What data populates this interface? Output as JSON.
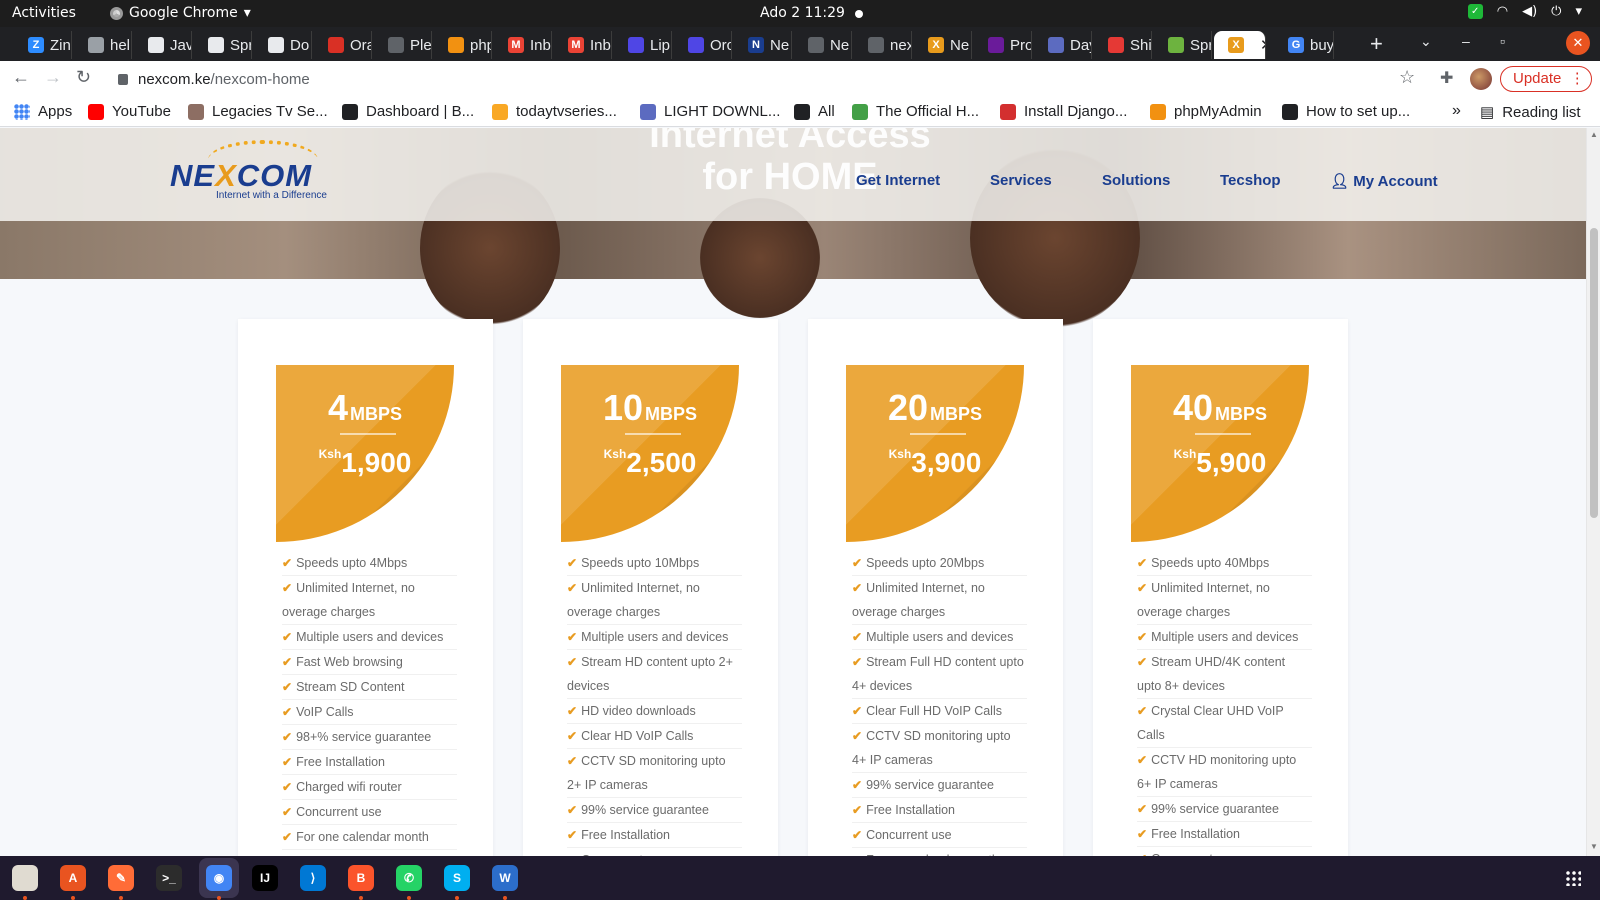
{
  "system_bar": {
    "activities": "Activities",
    "app_name": "Google Chrome",
    "clock": "Ado 2  11:29"
  },
  "tabs": [
    {
      "label": "Zin",
      "icon": "Z",
      "color": "#2d8cff"
    },
    {
      "label": "hel",
      "icon": "",
      "color": "#9aa0a6"
    },
    {
      "label": "Jav",
      "icon": "",
      "color": "#e8eaed"
    },
    {
      "label": "Spr",
      "icon": "",
      "color": "#e8eaed"
    },
    {
      "label": "Do",
      "icon": "",
      "color": "#e8eaed"
    },
    {
      "label": "Ora",
      "icon": "",
      "color": "#d93025"
    },
    {
      "label": "Ple",
      "icon": "",
      "color": "#5f6368"
    },
    {
      "label": "php",
      "icon": "",
      "color": "#f29111"
    },
    {
      "label": "Inb",
      "icon": "M",
      "color": "#ea4335"
    },
    {
      "label": "Inb",
      "icon": "M",
      "color": "#ea4335"
    },
    {
      "label": "Lip",
      "icon": "",
      "color": "#4f46e5"
    },
    {
      "label": "Orc",
      "icon": "",
      "color": "#4f46e5"
    },
    {
      "label": "Ne",
      "icon": "N",
      "color": "#1a3d8f"
    },
    {
      "label": "Ne",
      "icon": "",
      "color": "#5f6368"
    },
    {
      "label": "nex",
      "icon": "",
      "color": "#5f6368"
    },
    {
      "label": "Ne",
      "icon": "X",
      "color": "#e89b1c"
    },
    {
      "label": "Pro",
      "icon": "",
      "color": "#6a1b9a"
    },
    {
      "label": "Day",
      "icon": "",
      "color": "#5c6bc0"
    },
    {
      "label": "Shi",
      "icon": "",
      "color": "#e53935"
    },
    {
      "label": "Spr",
      "icon": "",
      "color": "#6db33f"
    },
    {
      "label": "",
      "icon": "X",
      "color": "#e89b1c",
      "active": true
    },
    {
      "label": "buy",
      "icon": "G",
      "color": "#4285f4"
    }
  ],
  "address_bar": {
    "domain": "nexcom.ke",
    "path": "/nexcom-home",
    "update_label": "Update"
  },
  "bookmarks": [
    {
      "label": "Apps",
      "color": "#4285f4"
    },
    {
      "label": "YouTube",
      "color": "#ff0000"
    },
    {
      "label": "Legacies Tv Se...",
      "color": "#8d6e63"
    },
    {
      "label": "Dashboard | B...",
      "color": "#202124"
    },
    {
      "label": "todaytvseries...",
      "color": "#f9a825"
    },
    {
      "label": "LIGHT DOWNL...",
      "color": "#5c6bc0"
    },
    {
      "label": "All",
      "color": "#202124"
    },
    {
      "label": "The Official H...",
      "color": "#43a047"
    },
    {
      "label": "Install Django...",
      "color": "#d32f2f"
    },
    {
      "label": "phpMyAdmin",
      "color": "#f29111"
    },
    {
      "label": "How to set up...",
      "color": "#202124"
    }
  ],
  "reading_list": "Reading list",
  "site": {
    "hero_title": "Internet Access for HOME",
    "logo": {
      "brand_a": "NE",
      "brand_x": "X",
      "brand_b": "COM",
      "tagline": "Internet with a Difference"
    },
    "nav": [
      "Get Internet",
      "Services",
      "Solutions",
      "Tecshop",
      "My Account"
    ]
  },
  "plans": [
    {
      "speed": "4",
      "unit": "MBPS",
      "currency": "Ksh",
      "price": "1,900",
      "features": [
        "Speeds upto 4Mbps",
        "Unlimited Internet, no overage charges",
        "Multiple users and devices",
        "Fast Web browsing",
        "Stream SD Content",
        "VoIP Calls",
        "98+% service guarantee",
        "Free Installation",
        "Charged wifi router",
        "Concurrent use",
        "For one calendar month"
      ]
    },
    {
      "speed": "10",
      "unit": "MBPS",
      "currency": "Ksh",
      "price": "2,500",
      "features": [
        "Speeds upto 10Mbps",
        "Unlimited Internet, no overage charges",
        "Multiple users and devices",
        "Stream HD content upto 2+ devices",
        "HD video downloads",
        "Clear HD VoIP Calls",
        "CCTV SD monitoring upto 2+ IP cameras",
        "99% service guarantee",
        "Free Installation",
        "Concurrent use"
      ]
    },
    {
      "speed": "20",
      "unit": "MBPS",
      "currency": "Ksh",
      "price": "3,900",
      "features": [
        "Speeds upto 20Mbps",
        "Unlimited Internet, no overage charges",
        "Multiple users and devices",
        "Stream Full HD content upto 4+ devices",
        "Clear Full HD VoIP Calls",
        "CCTV SD monitoring upto 4+ IP cameras",
        "99% service guarantee",
        "Free Installation",
        "Concurrent use",
        "For one calendar month"
      ]
    },
    {
      "speed": "40",
      "unit": "MBPS",
      "currency": "Ksh",
      "price": "5,900",
      "features": [
        "Speeds upto 40Mbps",
        "Unlimited Internet, no overage charges",
        "Multiple users and devices",
        "Stream UHD/4K content upto 8+ devices",
        "Crystal Clear UHD VoIP Calls",
        "CCTV HD monitoring upto 6+ IP cameras",
        "99% service guarantee",
        "Free Installation",
        "Concurrent use"
      ]
    }
  ],
  "dock": [
    {
      "name": "files",
      "color": "#e0dbd1",
      "glyph": ""
    },
    {
      "name": "software",
      "color": "#e95420",
      "glyph": "A"
    },
    {
      "name": "postman",
      "color": "#ff6c37",
      "glyph": "✎"
    },
    {
      "name": "terminal",
      "color": "#2c2c2c",
      "glyph": ">_"
    },
    {
      "name": "chrome",
      "color": "#4285f4",
      "glyph": "◉"
    },
    {
      "name": "intellij",
      "color": "#000000",
      "glyph": "IJ"
    },
    {
      "name": "vscode",
      "color": "#0078d4",
      "glyph": "⟩"
    },
    {
      "name": "brave",
      "color": "#fb542b",
      "glyph": "B"
    },
    {
      "name": "whatsapp",
      "color": "#25d366",
      "glyph": "✆"
    },
    {
      "name": "skype",
      "color": "#00aff0",
      "glyph": "S"
    },
    {
      "name": "wps-writer",
      "color": "#2c6ecb",
      "glyph": "W"
    }
  ]
}
